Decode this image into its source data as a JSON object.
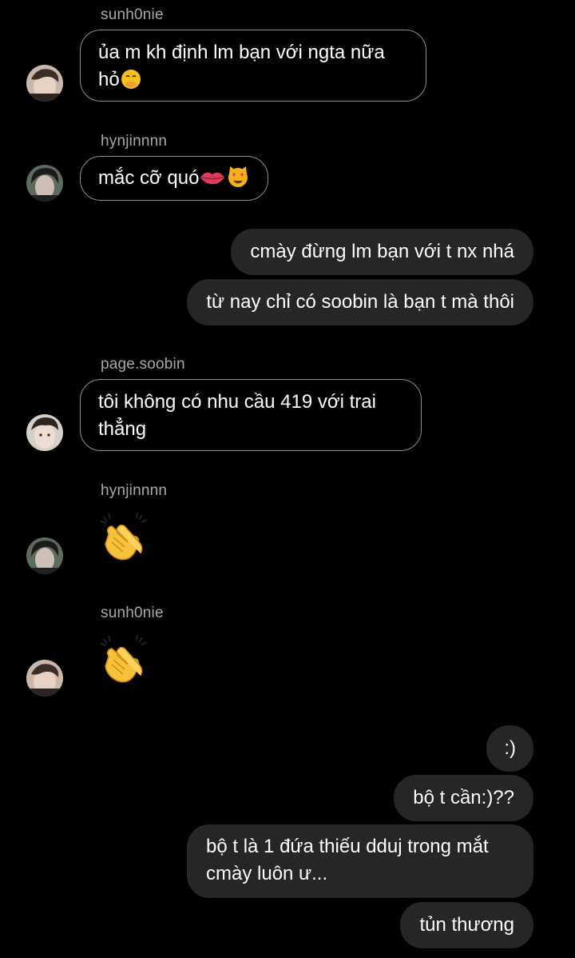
{
  "conversation": {
    "groups": [
      {
        "sender": "sunh0nie",
        "avatar": "avatar-sunh0nie",
        "messages": [
          {
            "text": "ủa m kh định lm bạn với ngta nữa hỏ",
            "emojis": [
              "face-with-hand-over-mouth"
            ]
          }
        ]
      },
      {
        "sender": "hynjinnnn",
        "avatar": "avatar-hynjinnnn",
        "messages": [
          {
            "text": "mắc cỡ quó",
            "emojis": [
              "lips",
              "heart-eyes-cat"
            ]
          }
        ]
      },
      {
        "sender": "page.soobin",
        "avatar": "avatar-page-soobin",
        "messages": [
          {
            "text": "tôi không có nhu cầu 419 với trai thẳng"
          }
        ]
      },
      {
        "sender": "hynjinnnn",
        "avatar": "avatar-hynjinnnn",
        "messages": [
          {
            "text": "",
            "emojis": [
              "clapping-hands"
            ]
          }
        ]
      },
      {
        "sender": "sunh0nie",
        "avatar": "avatar-sunh0nie",
        "messages": [
          {
            "text": "",
            "emojis": [
              "clapping-hands"
            ]
          }
        ]
      }
    ],
    "outgoing_block_1": [
      "cmày đừng lm bạn với t nx nhá",
      "từ nay chỉ có soobin là bạn t mà thôi"
    ],
    "outgoing_block_2": [
      ":)",
      "bộ t cần:)??",
      "bộ t là 1 đứa thiếu dduj trong mắt cmày luôn ư...",
      "tủn thương"
    ]
  },
  "colors": {
    "background": "#000000",
    "incoming_border": "#8e8e8e",
    "outgoing_fill": "#262629",
    "sender_name": "#a8a8a8",
    "text": "#ffffff"
  }
}
